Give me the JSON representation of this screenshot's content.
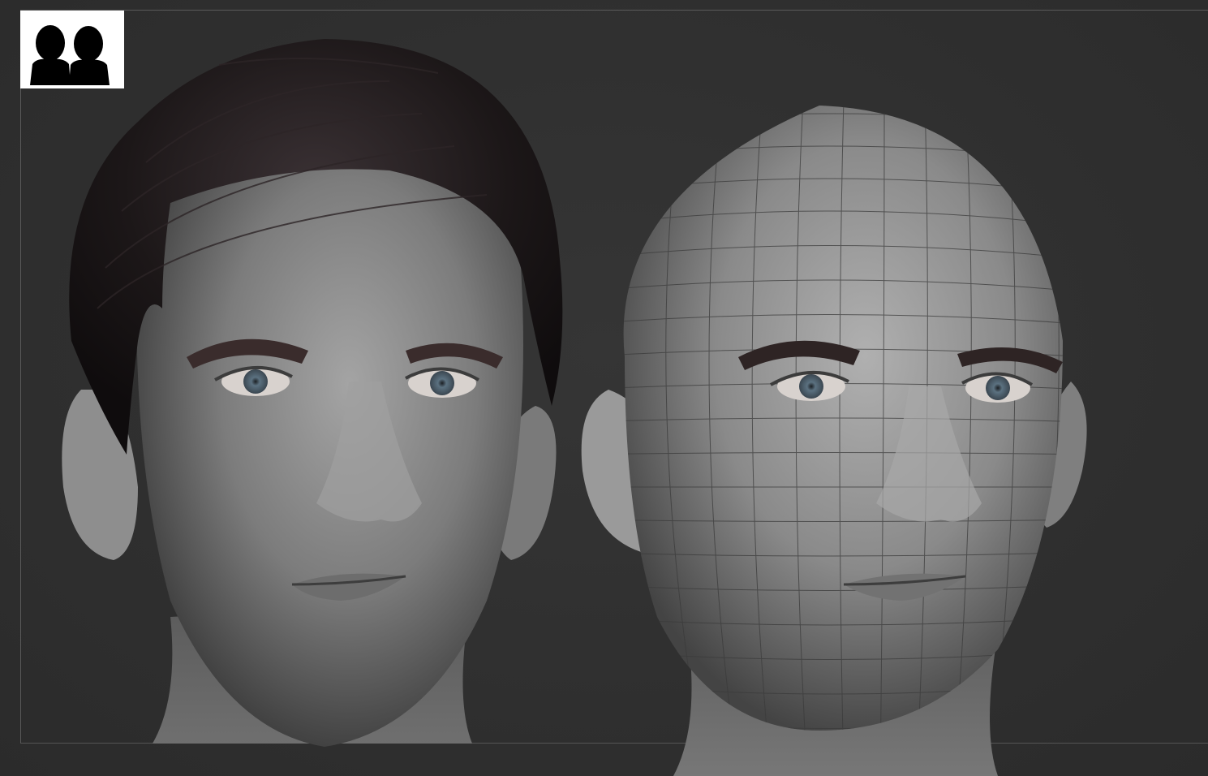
{
  "viewport": {
    "background_color": "#2f2f2f",
    "frame_color": "#5a5a5a"
  },
  "logo": {
    "icon": "two-silhouettes-icon",
    "background_color": "#ffffff",
    "figure_color": "#000000"
  },
  "models": [
    {
      "id": "sculpt-with-hair",
      "hair": true,
      "wireframe": false,
      "skin_color": "#8a8a8a",
      "hair_color": "#1c1718",
      "iris_color": "#5b7180"
    },
    {
      "id": "sculpt-bald-wireframe",
      "hair": false,
      "wireframe": true,
      "skin_color": "#9a9a9a",
      "brow_color": "#2e2424",
      "iris_color": "#5b7180"
    }
  ]
}
